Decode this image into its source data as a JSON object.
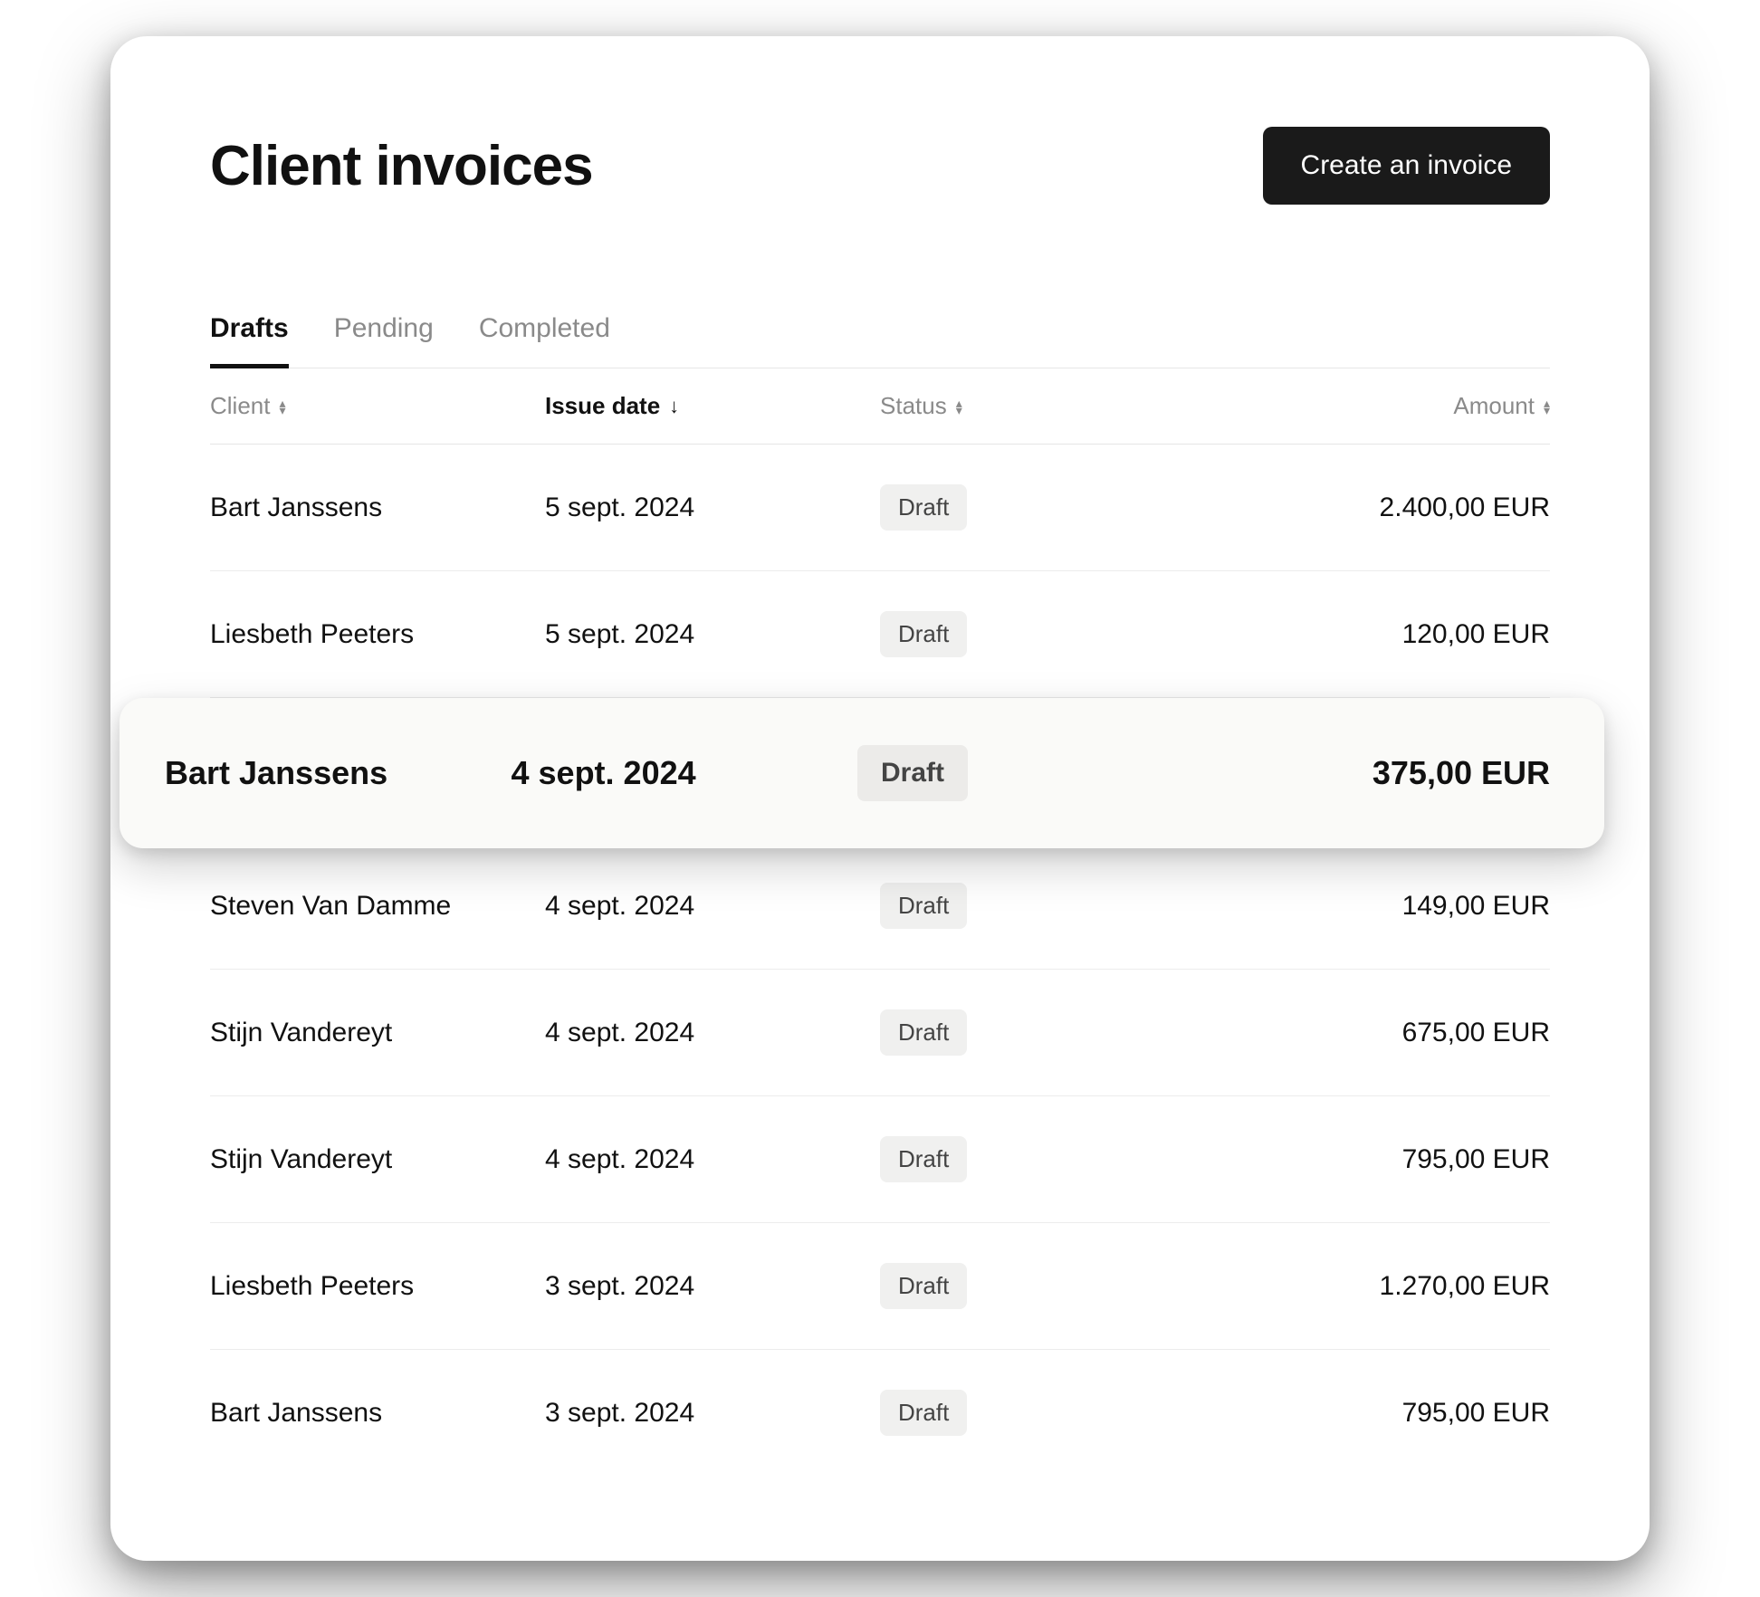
{
  "header": {
    "title": "Client invoices",
    "create_button": "Create an invoice"
  },
  "tabs": {
    "drafts": "Drafts",
    "pending": "Pending",
    "completed": "Completed",
    "active": "drafts"
  },
  "columns": {
    "client": "Client",
    "issue_date": "Issue date",
    "status": "Status",
    "amount": "Amount"
  },
  "rows": [
    {
      "client": "Bart Janssens",
      "issue_date": "5 sept. 2024",
      "status": "Draft",
      "amount": "2.400,00 EUR",
      "highlighted": false
    },
    {
      "client": "Liesbeth Peeters",
      "issue_date": "5 sept. 2024",
      "status": "Draft",
      "amount": "120,00 EUR",
      "highlighted": false
    },
    {
      "client": "Bart Janssens",
      "issue_date": "4 sept. 2024",
      "status": "Draft",
      "amount": "375,00 EUR",
      "highlighted": true
    },
    {
      "client": "Steven Van Damme",
      "issue_date": "4 sept. 2024",
      "status": "Draft",
      "amount": "149,00 EUR",
      "highlighted": false
    },
    {
      "client": "Stijn Vandereyt",
      "issue_date": "4 sept. 2024",
      "status": "Draft",
      "amount": "675,00 EUR",
      "highlighted": false
    },
    {
      "client": "Stijn Vandereyt",
      "issue_date": "4 sept. 2024",
      "status": "Draft",
      "amount": "795,00 EUR",
      "highlighted": false
    },
    {
      "client": "Liesbeth Peeters",
      "issue_date": "3 sept. 2024",
      "status": "Draft",
      "amount": "1.270,00 EUR",
      "highlighted": false
    },
    {
      "client": "Bart Janssens",
      "issue_date": "3 sept. 2024",
      "status": "Draft",
      "amount": "795,00 EUR",
      "highlighted": false
    }
  ]
}
